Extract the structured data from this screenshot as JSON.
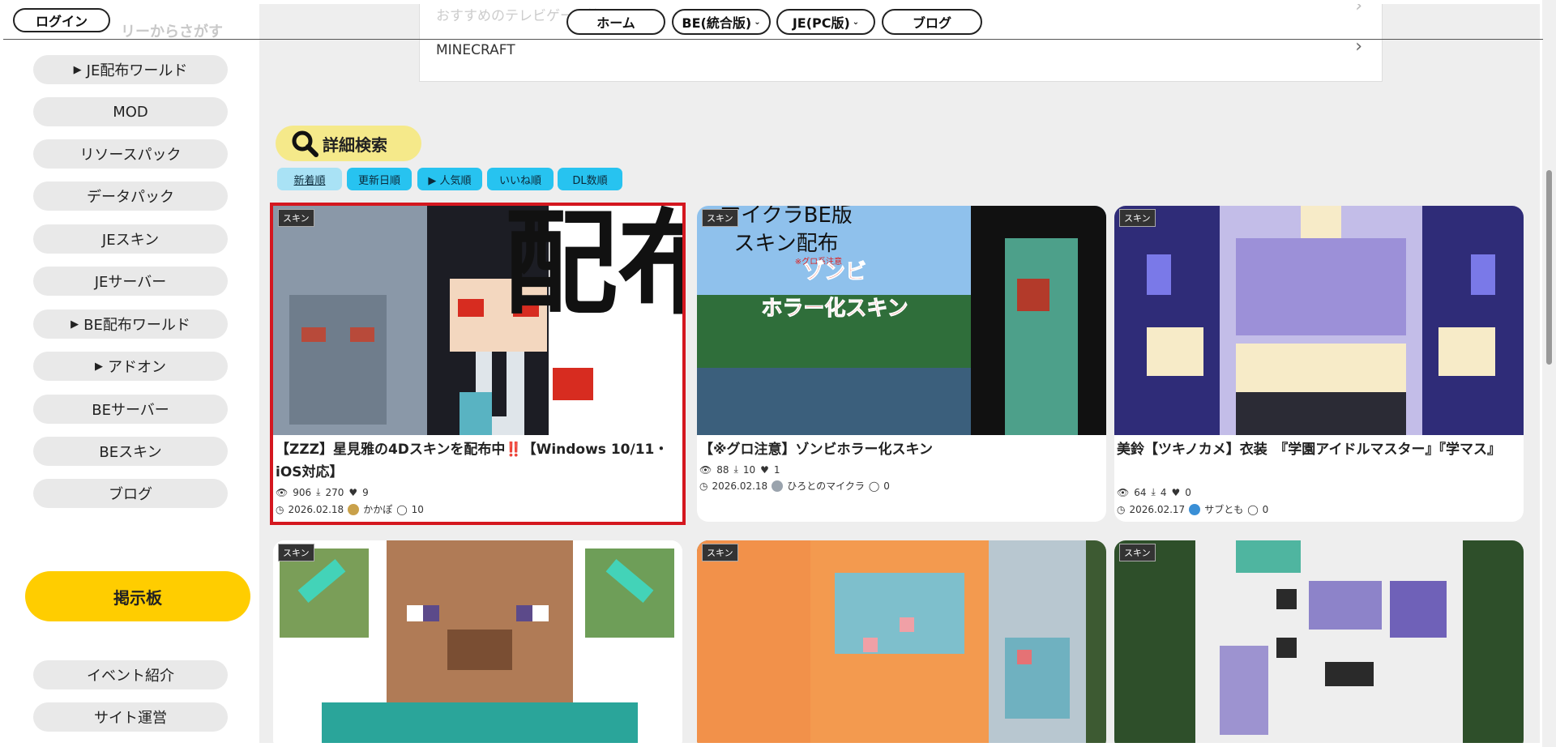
{
  "topbar": {
    "login_label": "ログイン",
    "home_label": "ホーム",
    "be_label": "BE(統合版)",
    "je_label": "JE(PC版)",
    "blog_label": "ブログ"
  },
  "sidebar": {
    "faded_label": "リーからさがす",
    "items": [
      {
        "label": "JE配布ワールド",
        "expandable": true
      },
      {
        "label": "MOD",
        "expandable": false
      },
      {
        "label": "リソースパック",
        "expandable": false
      },
      {
        "label": "データパック",
        "expandable": false
      },
      {
        "label": "JEスキン",
        "expandable": false
      },
      {
        "label": "JEサーバー",
        "expandable": false
      },
      {
        "label": "BE配布ワールド",
        "expandable": true
      },
      {
        "label": "アドオン",
        "expandable": true
      },
      {
        "label": "BEサーバー",
        "expandable": false
      },
      {
        "label": "BEスキン",
        "expandable": false
      },
      {
        "label": "ブログ",
        "expandable": false
      }
    ],
    "bbs_label": "掲示板",
    "bottom_items": [
      "イベント紹介",
      "サイト運営"
    ]
  },
  "categories": {
    "faded_label": "おすすめのテレビゲーム機",
    "row_label": "MINECRAFT"
  },
  "search": {
    "label": "詳細検索",
    "sorts": [
      "新着順",
      "更新日順",
      "▶ 人気順",
      "いいね順",
      "DL数順"
    ]
  },
  "cards": [
    {
      "tag": "スキン",
      "title": "【ZZZ】星見雅の4Dスキンを配布中‼️【Windows 10/11・iOS対応】",
      "views": "906",
      "downloads": "270",
      "likes": "9",
      "date": "2026.02.18",
      "author": "かかぽ",
      "comments": "10"
    },
    {
      "tag": "スキン",
      "title": "【※グロ注意】ゾンビホラー化スキン",
      "views": "88",
      "downloads": "10",
      "likes": "1",
      "date": "2026.02.18",
      "author": "ひろとのマイクラ",
      "comments": "0",
      "thumb_texts": [
        "マイクラBE版",
        "スキン配布",
        "※グロ系注意",
        "ゾンビ",
        "ホラー化スキン"
      ]
    },
    {
      "tag": "スキン",
      "title": "美鈴【ツキノカメ】衣装　『学園アイドルマスター』『学マス』",
      "views": "64",
      "downloads": "4",
      "likes": "0",
      "date": "2026.02.17",
      "author": "サブとも",
      "comments": "0"
    },
    {
      "tag": "スキン"
    },
    {
      "tag": "スキン"
    },
    {
      "tag": "スキン"
    }
  ],
  "card1_thumb_text": "配布",
  "colors": {
    "accent_yellow": "#ffcd00",
    "sort_blue": "#27c3f0",
    "selected_red": "#d4171f",
    "search_yellow": "#f5e98a"
  }
}
